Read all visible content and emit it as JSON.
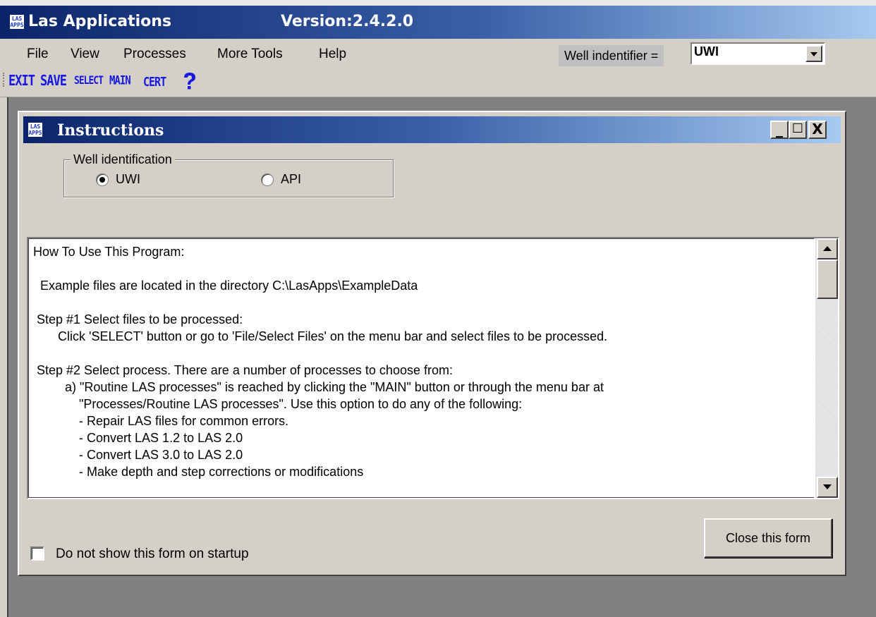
{
  "app": {
    "title": "Las Applications",
    "version": "Version:2.4.2.0",
    "logo_text": "LAS APPS"
  },
  "menubar": {
    "items": [
      "File",
      "View",
      "Processes",
      "More Tools",
      "Help"
    ],
    "well_identifier_label": "Well indentifier =",
    "well_identifier_value": "UWI"
  },
  "toolbar": {
    "exit": "EXIT",
    "save": "SAVE",
    "select": "SELECT",
    "main": "MAIN",
    "cert": "CERT",
    "help_icon": "question-mark-icon"
  },
  "form": {
    "title": "Instructions",
    "window_buttons": [
      "_",
      "☐",
      "X"
    ],
    "group_title": "Well identification",
    "options": [
      {
        "label": "UWI",
        "checked": true
      },
      {
        "label": "API",
        "checked": false
      }
    ],
    "instructions": [
      "How To Use This Program:",
      "",
      "  Example files are located in the directory C:\\LasApps\\ExampleData",
      "",
      " Step #1 Select files to be processed:",
      "       Click 'SELECT' button or go to 'File/Select Files' on the menu bar and select files to be processed.",
      "",
      " Step #2 Select process. There are a number of processes to choose from:",
      "         a) \"Routine LAS processes\" is reached by clicking the \"MAIN\" button or through the menu bar at",
      "             \"Processes/Routine LAS processes\". Use this option to do any of the following:",
      "             - Repair LAS files for common errors.",
      "             - Convert LAS 1.2 to LAS 2.0",
      "             - Convert LAS 3.0 to LAS 2.0",
      "             - Make depth and step corrections or modifications"
    ],
    "startup_checkbox_label": "Do not show this form on startup",
    "startup_checkbox_checked": false,
    "close_button": "Close this form"
  }
}
